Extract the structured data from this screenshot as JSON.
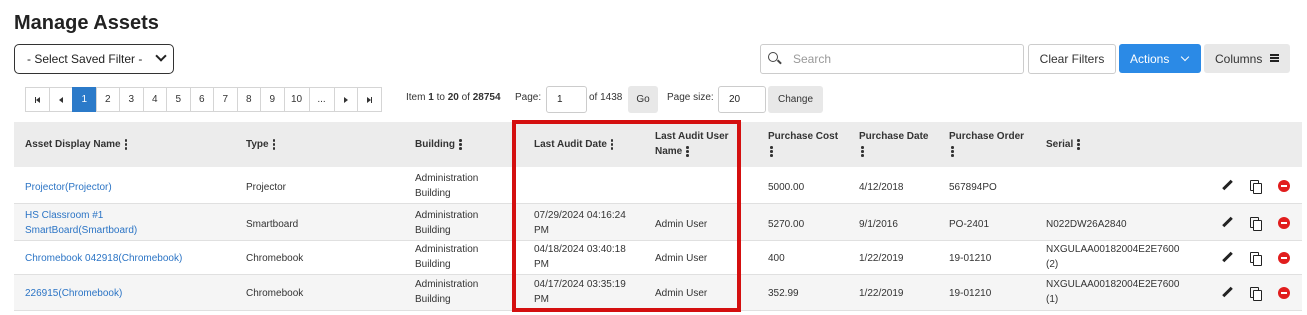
{
  "page": {
    "title": "Manage Assets"
  },
  "filter": {
    "saved_filter": "- Select Saved Filter -"
  },
  "search": {
    "placeholder": "Search"
  },
  "toolbar": {
    "clear_filters": "Clear Filters",
    "actions": "Actions",
    "columns": "Columns"
  },
  "pager": {
    "pages": [
      "1",
      "2",
      "3",
      "4",
      "5",
      "6",
      "7",
      "8",
      "9",
      "10",
      "..."
    ],
    "active_page": "1",
    "item_prefix": "Item ",
    "item_from": "1",
    "item_to_word": " to ",
    "item_to": "20",
    "item_of_word": " of ",
    "item_total": "28754",
    "page_label": "Page:",
    "page_value": "1",
    "page_of": "of 1438",
    "go_label": "Go",
    "size_label": "Page size:",
    "size_value": "20",
    "change_label": "Change"
  },
  "table": {
    "headers": {
      "asset_name": "Asset Display Name",
      "type": "Type",
      "building": "Building",
      "last_audit_date": "Last Audit Date",
      "last_audit_user_1": "Last Audit User",
      "last_audit_user_2": "Name",
      "purchase_cost": "Purchase Cost",
      "purchase_date": "Purchase Date",
      "purchase_order": "Purchase Order",
      "serial": "Serial"
    },
    "rows": [
      {
        "name_1": "Projector(Projector)",
        "name_2": "",
        "type": "Projector",
        "building_1": "Administration",
        "building_2": "Building",
        "audit_date_1": "",
        "audit_date_2": "",
        "audit_user": "",
        "cost": "5000.00",
        "pdate": "4/12/2018",
        "po": "567894PO",
        "serial_1": "",
        "serial_2": ""
      },
      {
        "name_1": "HS Classroom #1",
        "name_2": "SmartBoard(Smartboard)",
        "type": "Smartboard",
        "building_1": "Administration",
        "building_2": "Building",
        "audit_date_1": "07/29/2024 04:16:24",
        "audit_date_2": "PM",
        "audit_user": "Admin User",
        "cost": "5270.00",
        "pdate": "9/1/2016",
        "po": "PO-2401",
        "serial_1": "N022DW26A2840",
        "serial_2": ""
      },
      {
        "name_1": "Chromebook 042918(Chromebook)",
        "name_2": "",
        "type": "Chromebook",
        "building_1": "Administration",
        "building_2": "Building",
        "audit_date_1": "04/18/2024 03:40:18",
        "audit_date_2": "PM",
        "audit_user": "Admin User",
        "cost": "400",
        "pdate": "1/22/2019",
        "po": "19-01210",
        "serial_1": "NXGULAA00182004E2E7600",
        "serial_2": "(2)"
      },
      {
        "name_1": "226915(Chromebook)",
        "name_2": "",
        "type": "Chromebook",
        "building_1": "Administration",
        "building_2": "Building",
        "audit_date_1": "04/17/2024 03:35:19",
        "audit_date_2": "PM",
        "audit_user": "Admin User",
        "cost": "352.99",
        "pdate": "1/22/2019",
        "po": "19-01210",
        "serial_1": "NXGULAA00182004E2E7600",
        "serial_2": "(1)"
      }
    ]
  },
  "icons": {
    "edit": "pencil-icon",
    "copy": "copy-icon",
    "delete": "delete-icon",
    "search": "search-icon",
    "kebab": "kebab-menu-icon"
  },
  "colors": {
    "accent": "#2b8ae6",
    "active_page": "#2b7ac9",
    "link": "#2b74c5",
    "highlight": "#d40f0f",
    "delete": "#e11d1d"
  }
}
